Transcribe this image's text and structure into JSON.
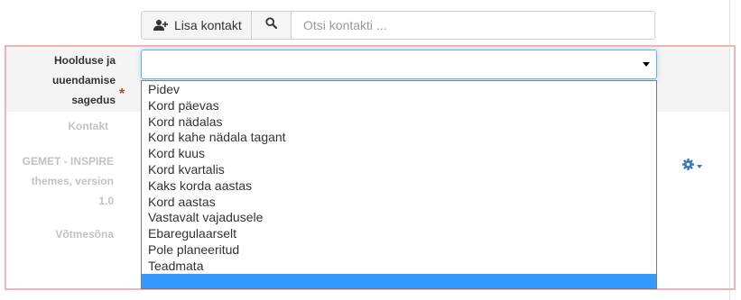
{
  "contact_toolbar": {
    "add_contact_label": "Lisa kontakt",
    "search_placeholder": "Otsi kontakti ..."
  },
  "maintenance_frequency": {
    "label_line1": "Hoolduse ja",
    "label_line2": "uuendamise",
    "label_line3": "sagedus",
    "required_mark": "*",
    "selected_value": "",
    "options": [
      "Pidev",
      "Kord päevas",
      "Kord nädalas",
      "Kord kahe nädala tagant",
      "Kord kuus",
      "Kord kvartalis",
      "Kaks korda aastas",
      "Kord aastas",
      "Vastavalt vajadusele",
      "Ebaregulaarselt",
      "Pole planeeritud",
      "Teadmata",
      ""
    ],
    "highlighted_option_index": 12
  },
  "background_fields": {
    "contact_label": "Kontakt",
    "gemet_line1": "GEMET - INSPIRE",
    "gemet_line2": "themes, version",
    "gemet_line3": "1.0",
    "keyword_label": "Võtmesõna"
  },
  "colors": {
    "highlight": "#3399ff",
    "focus_border": "#66afe9",
    "required": "#a94442",
    "section_outline": "#eeb3b9",
    "link_blue": "#337ab7"
  }
}
